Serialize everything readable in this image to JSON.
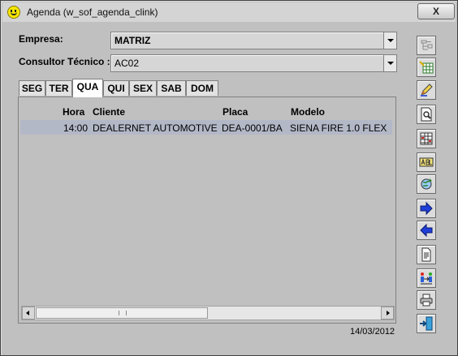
{
  "window": {
    "title": "Agenda  (w_sof_agenda_clink)",
    "close_label": "X"
  },
  "form": {
    "empresa_label": "Empresa:",
    "empresa_value": "MATRIZ",
    "consultor_label": "Consultor Técnico :",
    "consultor_value": "AC02"
  },
  "tabs": [
    {
      "label": "SEG"
    },
    {
      "label": "TER"
    },
    {
      "label": "QUA",
      "active": true
    },
    {
      "label": "QUI"
    },
    {
      "label": "SEX"
    },
    {
      "label": "SAB"
    },
    {
      "label": "DOM"
    }
  ],
  "table": {
    "headers": [
      "Hora",
      "Cliente",
      "Placa",
      "Modelo"
    ],
    "rows": [
      [
        "14:00",
        "DEALERNET AUTOMOTIVE I",
        "DEA-0001/BA",
        "SIENA FIRE 1.0 FLEX"
      ]
    ]
  },
  "status": {
    "date": "14/03/2012"
  },
  "toolbar": [
    "tree-view-icon",
    "table-edit-icon",
    "pencil-edit-icon",
    "search-document-icon",
    "grid-icon",
    "ab-label-icon",
    "refresh-globe-icon",
    "arrow-right-icon",
    "arrow-left-icon",
    "document-icon",
    "transfer-people-icon",
    "print-icon",
    "exit-door-icon"
  ],
  "colors": {
    "background": "#c0c0c0",
    "selected_row": "#b3b8c7",
    "arrow_blue": "#1f3fd8"
  }
}
